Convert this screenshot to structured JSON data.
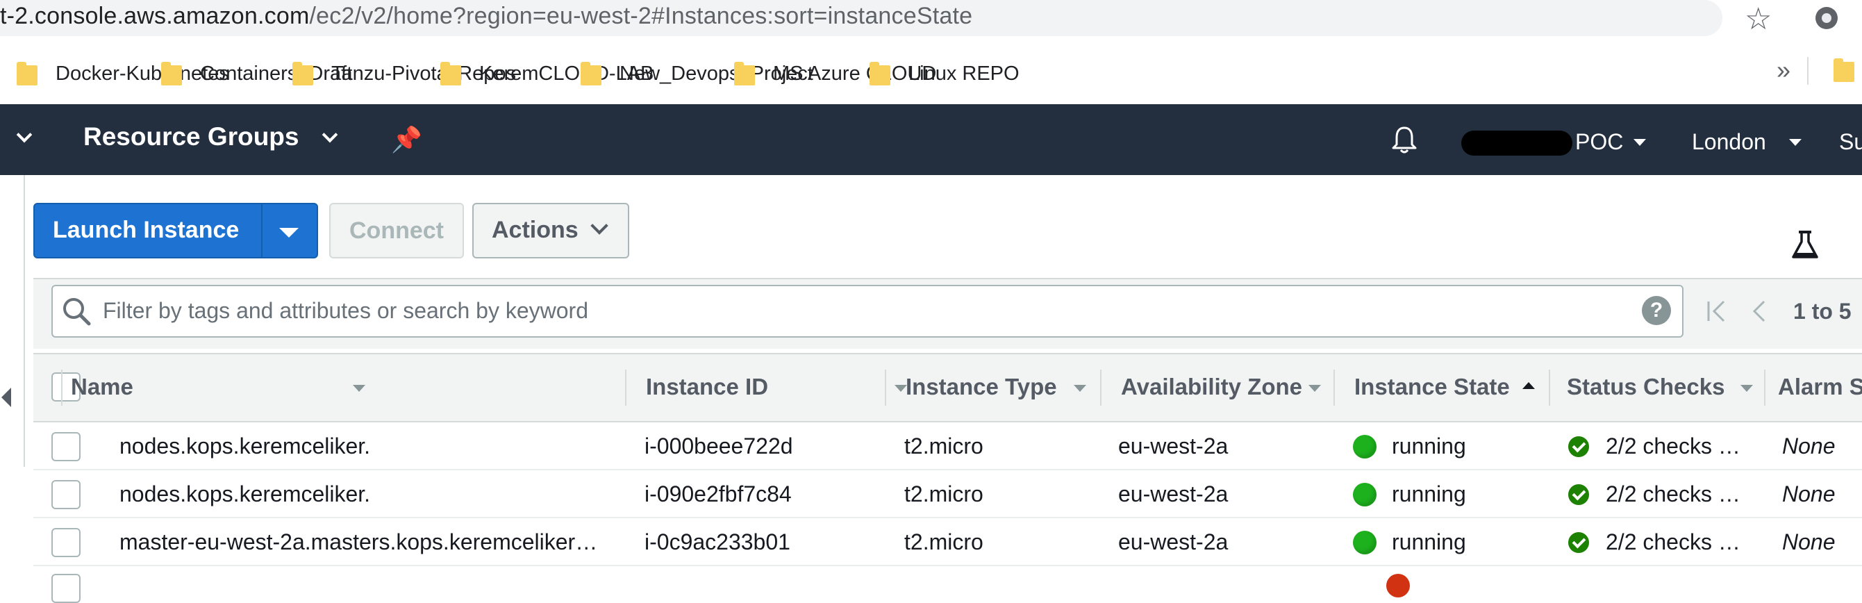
{
  "browser": {
    "url_main": "t-2.console.aws.amazon.com",
    "url_path": "/ec2/v2/home?region=eu-west-2#Instances:sort=instanceState",
    "bookmarks": [
      {
        "label": "Docker-Kubernetes"
      },
      {
        "label": "Containers_Draft"
      },
      {
        "label": "Tanzu-Pivotal Repos"
      },
      {
        "label": "KeremCLOUD-LAB"
      },
      {
        "label": "New_Devops_Project"
      },
      {
        "label": "MS Azure CLOUD"
      },
      {
        "label": "Linux REPO"
      }
    ],
    "more_bookmarks": "»"
  },
  "nav": {
    "resource_groups": "Resource Groups",
    "account": "POC",
    "region": "London",
    "support_partial": "Su"
  },
  "toolbar": {
    "launch": "Launch Instance",
    "connect": "Connect",
    "actions": "Actions"
  },
  "filter": {
    "placeholder": "Filter by tags and attributes or search by keyword",
    "help": "?",
    "range": "1 to 5"
  },
  "table": {
    "columns": {
      "name": "Name",
      "instance_id": "Instance ID",
      "instance_type": "Instance Type",
      "az": "Availability Zone",
      "state": "Instance State",
      "status": "Status Checks",
      "alarm": "Alarm S"
    },
    "rows": [
      {
        "name": "nodes.kops.keremceliker.",
        "instance_id": "i-000beee722d",
        "instance_type": "t2.micro",
        "az": "eu-west-2a",
        "state": "running",
        "status": "2/2 checks …",
        "alarm": "None"
      },
      {
        "name": "nodes.kops.keremceliker.",
        "instance_id": "i-090e2fbf7c84",
        "instance_type": "t2.micro",
        "az": "eu-west-2a",
        "state": "running",
        "status": "2/2 checks …",
        "alarm": "None"
      },
      {
        "name": "master-eu-west-2a.masters.kops.keremceliker…",
        "instance_id": "i-0c9ac233b01",
        "instance_type": "t2.micro",
        "az": "eu-west-2a",
        "state": "running",
        "status": "2/2 checks …",
        "alarm": "None"
      }
    ]
  },
  "colors": {
    "nav_bg": "#232f3e",
    "primary": "#1d72d2",
    "running": "#1db11d",
    "check_ok": "#1d8102",
    "stopped": "#d13212"
  }
}
